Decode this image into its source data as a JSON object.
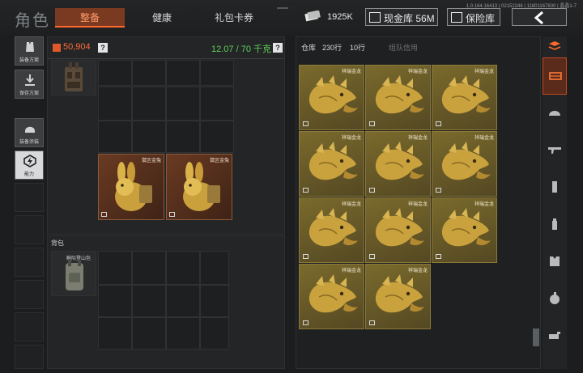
{
  "header": {
    "title": "角色",
    "tabs": [
      {
        "label": "整备",
        "active": true
      },
      {
        "label": "健康",
        "active": false
      },
      {
        "label": "礼包卡券",
        "active": false
      }
    ],
    "version": "1.0.164.16413 | 02152246 | 11801167830 | 晶晶1-7",
    "coins": "1925K",
    "coin_icon": "ticket-icon",
    "cash_store": "现金库 56M",
    "safe_box": "保险库",
    "back_icon": "chevron-left-icon"
  },
  "colors": {
    "accent": "#ff6a2a",
    "weight_green": "#5ed15a",
    "item_bronze": "#6a3a22",
    "item_gold": "#7a6a2c"
  },
  "sidebar": {
    "items": [
      {
        "label": "装备方案",
        "icon": "vest-icon"
      },
      {
        "label": "保存方案",
        "icon": "download-icon"
      },
      {
        "label": "装备涂装",
        "icon": "helmet-icon"
      },
      {
        "label": "能力",
        "icon": "ability-icon",
        "active": true
      }
    ]
  },
  "equip": {
    "money": "50,904",
    "money_help": "?",
    "weight": "12.07 / 70 千克",
    "weight_help": "?",
    "items": [
      {
        "name": "鼠区金兔"
      },
      {
        "name": "鼠区金兔"
      }
    ]
  },
  "backpack": {
    "label": "背包",
    "item_name": "鲜际登山包"
  },
  "warehouse": {
    "title": "仓库",
    "rows_house": "230行",
    "rows_tag": "10行",
    "team_credit": "组队信用",
    "items": [
      {
        "name": "祥瑞金龙"
      },
      {
        "name": "祥瑞金龙"
      },
      {
        "name": "祥瑞金龙"
      },
      {
        "name": "祥瑞金龙"
      },
      {
        "name": "祥瑞金龙"
      },
      {
        "name": "祥瑞金龙"
      },
      {
        "name": "祥瑞金龙"
      },
      {
        "name": "祥瑞金龙"
      },
      {
        "name": "祥瑞金龙"
      },
      {
        "name": "祥瑞金龙"
      },
      {
        "name": "祥瑞金龙"
      }
    ]
  },
  "categories": [
    "stack-icon",
    "tray-icon",
    "helmet-icon",
    "rifle-icon",
    "magazine-icon",
    "bottle-icon",
    "armor-icon",
    "grenade-icon",
    "key-icon"
  ]
}
